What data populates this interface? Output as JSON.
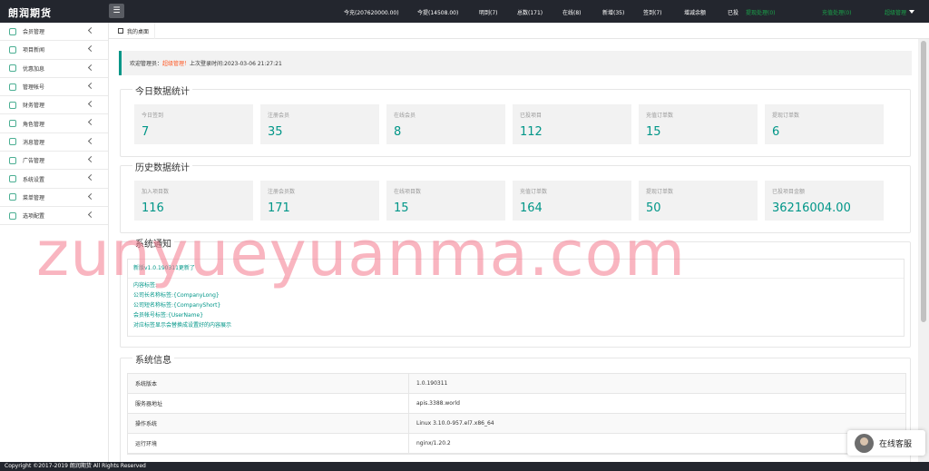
{
  "app": {
    "logo": "朗润期货"
  },
  "topnav": [
    {
      "label": "今充(207620000.00)",
      "green": false
    },
    {
      "label": "今提(14508.00)",
      "green": false
    },
    {
      "label": "明到(7)",
      "green": false
    },
    {
      "label": "总数(171)",
      "green": false
    },
    {
      "label": "在线(8)",
      "green": false
    },
    {
      "label": "新增(35)",
      "green": false
    },
    {
      "label": "签到(7)",
      "green": false
    },
    {
      "label": "增减余额",
      "green": false
    },
    {
      "label": "已投",
      "green": false
    },
    {
      "label": "提现处理(0)",
      "green": true
    },
    {
      "label": "充值处理(0)",
      "green": true
    },
    {
      "label": "超级管理",
      "green": true
    }
  ],
  "sidebar": [
    {
      "label": "会员管理"
    },
    {
      "label": "项目新闻"
    },
    {
      "label": "优惠加息"
    },
    {
      "label": "管理帐号"
    },
    {
      "label": "财务管理"
    },
    {
      "label": "角色管理"
    },
    {
      "label": "消息管理"
    },
    {
      "label": "广告管理"
    },
    {
      "label": "系统设置"
    },
    {
      "label": "菜单管理"
    },
    {
      "label": "选项配置"
    }
  ],
  "tab": {
    "label": "我的桌面"
  },
  "welcome": {
    "prefix": "欢迎管理员：",
    "role": "超级管理！",
    "login": "上次登录时间:2023-03-06 21:27:21"
  },
  "today": {
    "title": "今日数据统计",
    "cards": [
      {
        "label": "今日签到",
        "value": "7"
      },
      {
        "label": "注册会员",
        "value": "35"
      },
      {
        "label": "在线会员",
        "value": "8"
      },
      {
        "label": "已投项目",
        "value": "112"
      },
      {
        "label": "充值订单数",
        "value": "15"
      },
      {
        "label": "提现订单数",
        "value": "6"
      }
    ]
  },
  "history": {
    "title": "历史数据统计",
    "cards": [
      {
        "label": "加入项目数",
        "value": "116"
      },
      {
        "label": "注册会员数",
        "value": "171"
      },
      {
        "label": "在线项目数",
        "value": "15"
      },
      {
        "label": "充值订单数",
        "value": "164"
      },
      {
        "label": "提现订单数",
        "value": "50"
      },
      {
        "label": "已投项目金额",
        "value": "36216004.00"
      }
    ]
  },
  "notice": {
    "title": "系统通知",
    "version_line": "新版v1.0.190311更新了",
    "lines": [
      "内容标签:",
      "公司长名称标签:{CompanyLong}",
      "公司短名称标签:{CompanyShort}",
      "会员帐号标签:{UserName}",
      "对应标签显示会替换成设置好的内容展示"
    ]
  },
  "sysinfo": {
    "title": "系统信息",
    "rows": [
      {
        "k": "系统版本",
        "v": "1.0.190311"
      },
      {
        "k": "服务器地址",
        "v": "apis.3388.world"
      },
      {
        "k": "操作系统",
        "v": "Linux 3.10.0-957.el7.x86_64"
      },
      {
        "k": "运行环境",
        "v": "nginx/1.20.2"
      }
    ]
  },
  "footer": "Copyright ©2017-2019 朗润期货 All Rights Reserved",
  "service": "在线客服",
  "watermark": "zunyueyuanma.com"
}
